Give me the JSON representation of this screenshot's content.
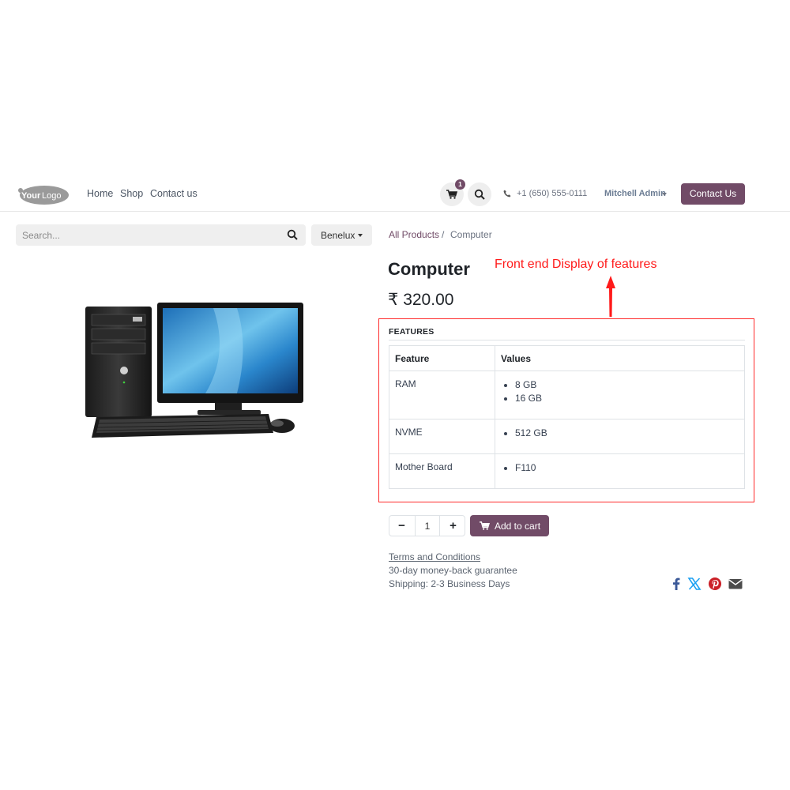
{
  "header": {
    "logo_text": "YourLogo",
    "nav": [
      "Home",
      "Shop",
      "Contact us"
    ],
    "cart_count": "1",
    "phone": "+1 (650) 555-0111",
    "user": "Mitchell Admin",
    "contact_button": "Contact Us"
  },
  "search": {
    "placeholder": "Search...",
    "value": ""
  },
  "pricelist": {
    "selected": "Benelux"
  },
  "breadcrumb": {
    "parent": "All Products",
    "separator": "/",
    "current": "Computer"
  },
  "product": {
    "name": "Computer",
    "price": "₹ 320.00",
    "image": "desktop-computer-with-monitor-keyboard-mouse"
  },
  "annotation": "Front end Display of features",
  "features": {
    "title": "FEATURES",
    "headers": {
      "feature": "Feature",
      "values": "Values"
    },
    "rows": [
      {
        "feature": "RAM",
        "values": [
          "8 GB",
          "16 GB"
        ]
      },
      {
        "feature": "NVME",
        "values": [
          "512 GB"
        ]
      },
      {
        "feature": "Mother Board",
        "values": [
          "F110"
        ]
      }
    ]
  },
  "cart": {
    "quantity": "1",
    "minus": "−",
    "plus": "+",
    "add_label": "Add to cart"
  },
  "info": {
    "terms": "Terms and Conditions",
    "guarantee": "30-day money-back guarantee",
    "shipping": "Shipping: 2-3 Business Days"
  },
  "share_icons": [
    "facebook-icon",
    "x-icon",
    "pinterest-icon",
    "email-icon"
  ],
  "colors": {
    "brand": "#714b67",
    "annotation": "#ff1a1a",
    "facebook": "#3b5998",
    "x": "#1da1f2",
    "pinterest": "#cb2027",
    "email": "#4b4b4b"
  }
}
